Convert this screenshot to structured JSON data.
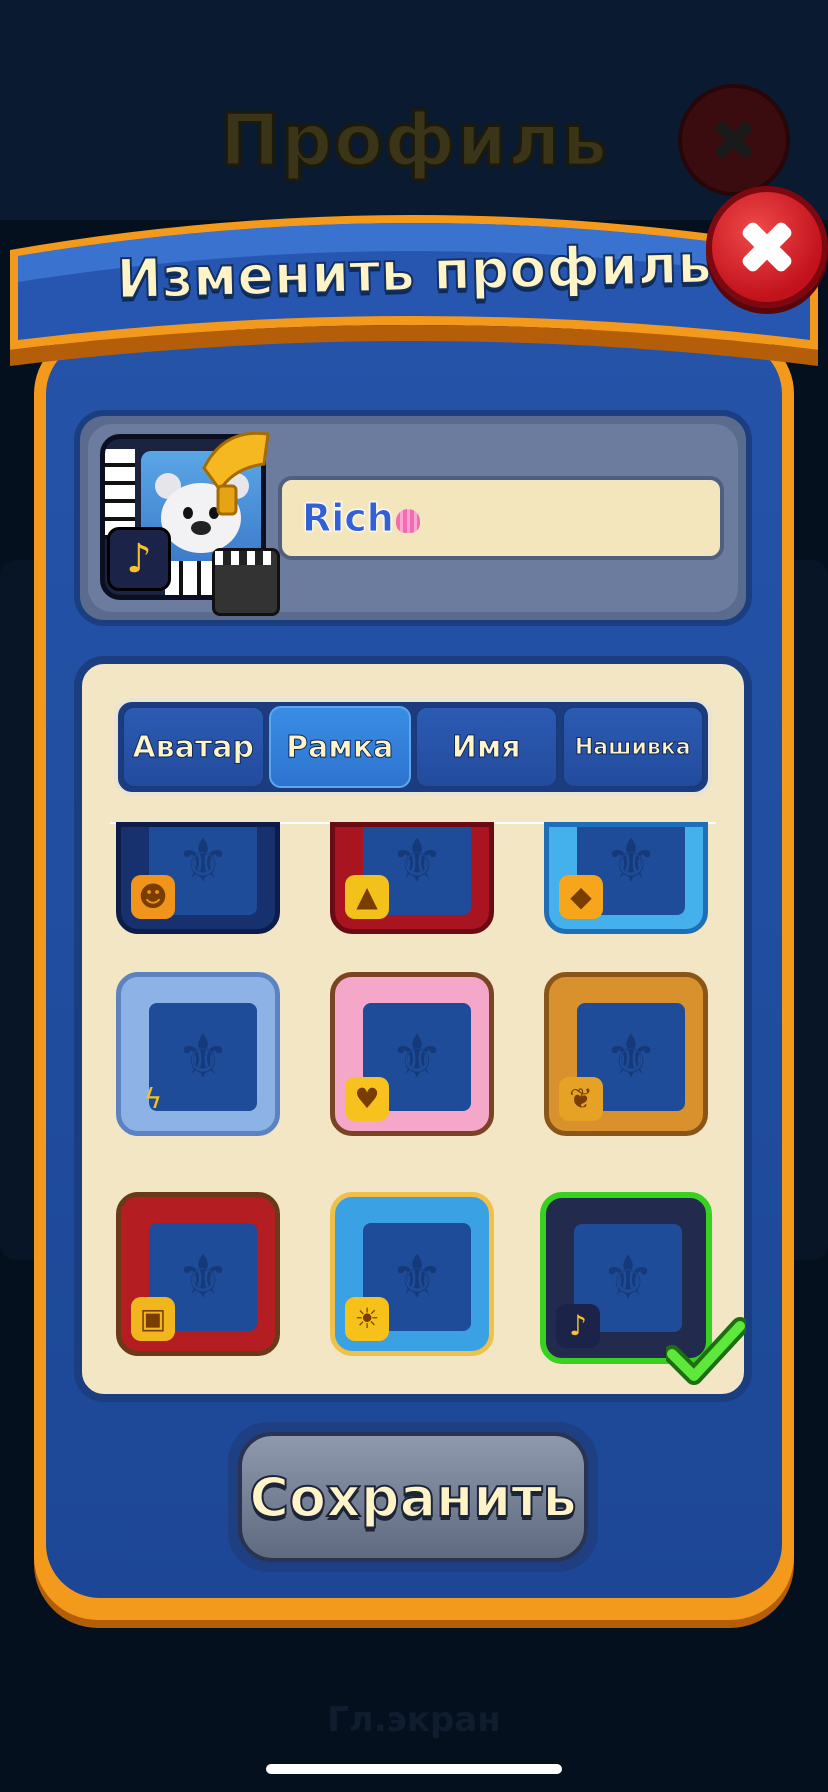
{
  "background": {
    "title": "Профиль",
    "bottom_label": "Гл.экран"
  },
  "modal": {
    "title": "Изменить профиль",
    "close_icon": "close-x-icon"
  },
  "profile": {
    "name": "Rich",
    "avatar_icon": "polar-bear-avatar",
    "frame_icon": "music-frame-icon"
  },
  "tabs": [
    {
      "label": "Аватар",
      "selected": false
    },
    {
      "label": "Рамка",
      "selected": true
    },
    {
      "label": "Имя",
      "selected": false
    },
    {
      "label": "Нашивка",
      "selected": false
    }
  ],
  "frames": [
    {
      "theme": "halloween-storm",
      "badge_icon": "pumpkin-icon",
      "selected": false
    },
    {
      "theme": "christmas-lights",
      "badge_icon": "tree-icon",
      "selected": false
    },
    {
      "theme": "ice-snow",
      "badge_icon": "diamond-icon",
      "selected": false
    },
    {
      "theme": "storm-cloud",
      "badge_icon": "lightning-icon",
      "selected": false
    },
    {
      "theme": "candy-sweets",
      "badge_icon": "heart-icon",
      "selected": false
    },
    {
      "theme": "easter-basket",
      "badge_icon": "leaf-icon",
      "selected": false
    },
    {
      "theme": "theater-curtain",
      "badge_icon": "clapper-icon",
      "selected": false
    },
    {
      "theme": "pool-beach",
      "badge_icon": "sun-icon",
      "selected": false
    },
    {
      "theme": "music-piano",
      "badge_icon": "music-note-icon",
      "selected": true
    }
  ],
  "save_button": {
    "label": "Сохранить"
  },
  "colors": {
    "modal_orange": "#f39a1c",
    "modal_blue": "#2453a8",
    "selected_green": "#38d021",
    "close_red": "#c2121c"
  }
}
